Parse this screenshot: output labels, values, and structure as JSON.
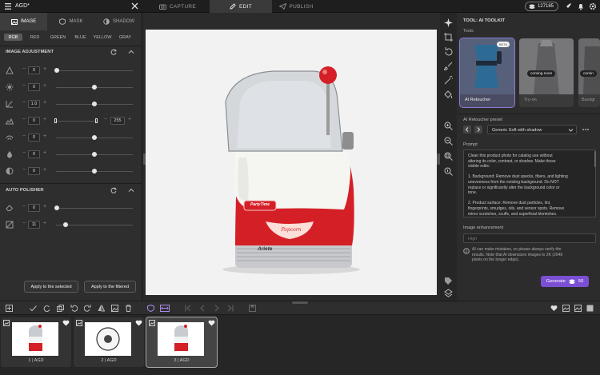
{
  "app": {
    "title": "AGD*"
  },
  "top_tabs": [
    {
      "label": "CAPTURE",
      "icon": "camera-icon"
    },
    {
      "label": "EDIT",
      "icon": "pencil-icon"
    },
    {
      "label": "PUBLISH",
      "icon": "send-icon"
    }
  ],
  "credits": {
    "value": "127185"
  },
  "left_panel": {
    "tabs": [
      {
        "label": "IMAGE",
        "icon": "image-icon"
      },
      {
        "label": "MASK",
        "icon": "mask-icon"
      },
      {
        "label": "SHADOW",
        "icon": "shadow-icon"
      }
    ],
    "channels": [
      "RGB",
      "RED",
      "GREEN",
      "BLUE",
      "YELLOW",
      "GRAY"
    ],
    "adjustment_title": "IMAGE ADJUSTMENT",
    "adjustments": [
      {
        "icon": "exposure-icon",
        "value": "0"
      },
      {
        "icon": "contrast-icon",
        "value": "0"
      },
      {
        "icon": "gamma-icon",
        "value": "1.0"
      },
      {
        "icon": "levels-icon",
        "value": "0",
        "value2": "255"
      },
      {
        "icon": "curve-icon",
        "value": "0"
      },
      {
        "icon": "saturation-icon",
        "value": "0"
      },
      {
        "icon": "hue-icon",
        "value": "0"
      }
    ],
    "polisher_title": "AUTO POLISHER",
    "polisher": [
      {
        "icon": "eraser-icon",
        "value": "0"
      },
      {
        "icon": "sharpen-icon",
        "value": "11"
      }
    ],
    "apply_selected": "Apply to the selected",
    "apply_filtered": "Apply to the filtered"
  },
  "right_panel": {
    "title": "TOOL: AI TOOLKIT",
    "tools_label": "Tools",
    "tools": [
      {
        "label": "AI Retoucher",
        "badge": "BETA"
      },
      {
        "label": "Try-on",
        "badge": "coming soon"
      },
      {
        "label": "Backgr",
        "badge": "comin"
      }
    ],
    "preset_label": "AI Retoucher preset",
    "preset_value": "Generic Soft with shadow",
    "prompt_label": "Prompt",
    "prompt_lines": [
      "Clean this product photo for catalog use without",
      "altering its color, contrast, or shadow. Make these",
      "visible edits:",
      "",
      "1. Background: Remove dust specks, fibers, and lighting",
      "unevenness from the existing background. Do NOT",
      "replace or significantly alter the background color or",
      "tone.",
      "",
      "2. Product surface: Remove dust particles, lint,",
      "fingerprints, smudges, oils, and sensor spots. Remove",
      "minor scratches, scuffs, and superficial blemishes."
    ],
    "enhancement_label": "Image enhancement",
    "enhancement_value": "High",
    "notice_lines": [
      "AI can make mistakes, so please always verify the",
      "results. Note that AI downsizes images to 2K (2048",
      "pixels on the longer edge)."
    ],
    "generate_label": "Generate",
    "generate_cost": "50"
  },
  "product": {
    "brand": "Ariete",
    "badge": "PartyTime",
    "script": "Popcorn"
  },
  "filmstrip": [
    {
      "label": "1 | AGD"
    },
    {
      "label": "2 | AGD"
    },
    {
      "label": "3 | AGD"
    }
  ],
  "colors": {
    "accent": "#7b4fd4",
    "panel": "#2e2e2e",
    "product_red": "#d51f26"
  }
}
